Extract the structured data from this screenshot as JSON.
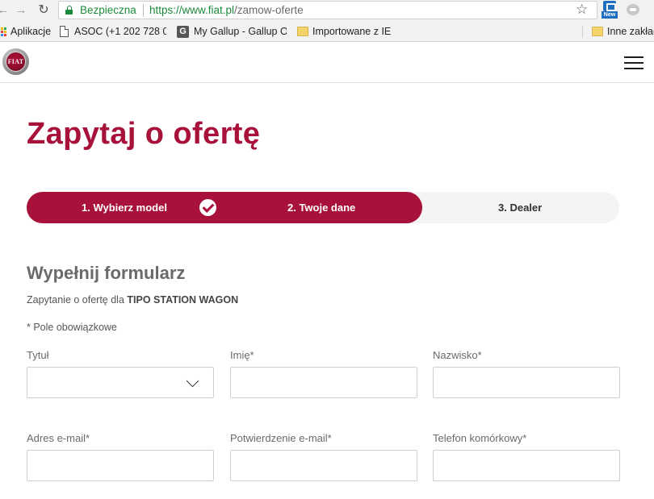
{
  "browser": {
    "secure_label": "Bezpieczna",
    "url_base": "https://www.fiat.pl",
    "url_path": "/zamow-oferte",
    "extension_badge": "New",
    "bookmarks": [
      {
        "label": "Aplikacje",
        "icon": "apps-icon"
      },
      {
        "label": "ASOC (+1 202 728 06",
        "icon": "page-icon"
      },
      {
        "label": "My Gallup - Gallup Or",
        "icon": "g-icon"
      },
      {
        "label": "Importowane z IE",
        "icon": "folder-icon"
      },
      {
        "label": "Inne zakład",
        "icon": "folder-icon"
      }
    ]
  },
  "header": {
    "logo_text": "FIAT"
  },
  "page": {
    "title": "Zapytaj o ofertę",
    "steps": [
      {
        "label": "1. Wybierz model",
        "status": "completed"
      },
      {
        "label": "2. Twoje dane",
        "status": "active"
      },
      {
        "label": "3. Dealer",
        "status": "pending"
      }
    ],
    "form_title": "Wypełnij formularz",
    "offer_prefix": "Zapytanie o ofertę dla",
    "offer_model": "TIPO STATION WAGON",
    "required_note": "* Pole obowiązkowe",
    "fields": {
      "title": {
        "label": "Tytuł",
        "value": ""
      },
      "first_name": {
        "label": "Imię*",
        "value": ""
      },
      "last_name": {
        "label": "Nazwisko*",
        "value": ""
      },
      "email": {
        "label": "Adres e-mail*",
        "value": ""
      },
      "email_confirm": {
        "label": "Potwierdzenie e-mail*",
        "value": ""
      },
      "mobile": {
        "label": "Telefon komórkowy*",
        "value": ""
      }
    }
  },
  "colors": {
    "brand": "#a8123a",
    "secure_green": "#1a8a3a",
    "stepper_bg": "#f4f4f4"
  }
}
